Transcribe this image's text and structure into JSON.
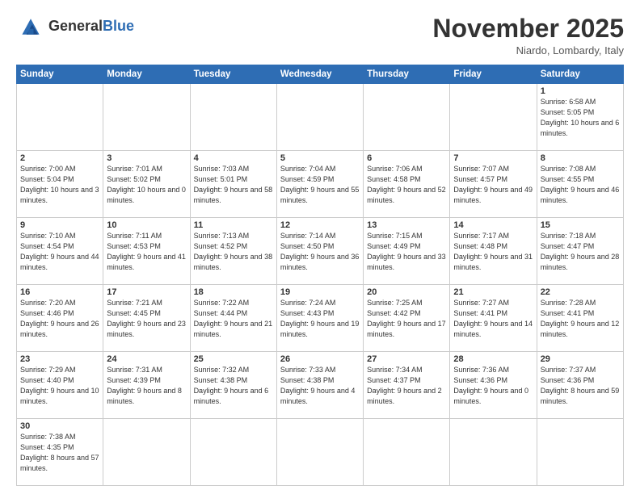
{
  "header": {
    "logo_general": "General",
    "logo_blue": "Blue",
    "month_title": "November 2025",
    "location": "Niardo, Lombardy, Italy"
  },
  "days_of_week": [
    "Sunday",
    "Monday",
    "Tuesday",
    "Wednesday",
    "Thursday",
    "Friday",
    "Saturday"
  ],
  "weeks": [
    [
      {
        "day": "",
        "info": ""
      },
      {
        "day": "",
        "info": ""
      },
      {
        "day": "",
        "info": ""
      },
      {
        "day": "",
        "info": ""
      },
      {
        "day": "",
        "info": ""
      },
      {
        "day": "",
        "info": ""
      },
      {
        "day": "1",
        "info": "Sunrise: 6:58 AM\nSunset: 5:05 PM\nDaylight: 10 hours and 6 minutes."
      }
    ],
    [
      {
        "day": "2",
        "info": "Sunrise: 7:00 AM\nSunset: 5:04 PM\nDaylight: 10 hours and 3 minutes."
      },
      {
        "day": "3",
        "info": "Sunrise: 7:01 AM\nSunset: 5:02 PM\nDaylight: 10 hours and 0 minutes."
      },
      {
        "day": "4",
        "info": "Sunrise: 7:03 AM\nSunset: 5:01 PM\nDaylight: 9 hours and 58 minutes."
      },
      {
        "day": "5",
        "info": "Sunrise: 7:04 AM\nSunset: 4:59 PM\nDaylight: 9 hours and 55 minutes."
      },
      {
        "day": "6",
        "info": "Sunrise: 7:06 AM\nSunset: 4:58 PM\nDaylight: 9 hours and 52 minutes."
      },
      {
        "day": "7",
        "info": "Sunrise: 7:07 AM\nSunset: 4:57 PM\nDaylight: 9 hours and 49 minutes."
      },
      {
        "day": "8",
        "info": "Sunrise: 7:08 AM\nSunset: 4:55 PM\nDaylight: 9 hours and 46 minutes."
      }
    ],
    [
      {
        "day": "9",
        "info": "Sunrise: 7:10 AM\nSunset: 4:54 PM\nDaylight: 9 hours and 44 minutes."
      },
      {
        "day": "10",
        "info": "Sunrise: 7:11 AM\nSunset: 4:53 PM\nDaylight: 9 hours and 41 minutes."
      },
      {
        "day": "11",
        "info": "Sunrise: 7:13 AM\nSunset: 4:52 PM\nDaylight: 9 hours and 38 minutes."
      },
      {
        "day": "12",
        "info": "Sunrise: 7:14 AM\nSunset: 4:50 PM\nDaylight: 9 hours and 36 minutes."
      },
      {
        "day": "13",
        "info": "Sunrise: 7:15 AM\nSunset: 4:49 PM\nDaylight: 9 hours and 33 minutes."
      },
      {
        "day": "14",
        "info": "Sunrise: 7:17 AM\nSunset: 4:48 PM\nDaylight: 9 hours and 31 minutes."
      },
      {
        "day": "15",
        "info": "Sunrise: 7:18 AM\nSunset: 4:47 PM\nDaylight: 9 hours and 28 minutes."
      }
    ],
    [
      {
        "day": "16",
        "info": "Sunrise: 7:20 AM\nSunset: 4:46 PM\nDaylight: 9 hours and 26 minutes."
      },
      {
        "day": "17",
        "info": "Sunrise: 7:21 AM\nSunset: 4:45 PM\nDaylight: 9 hours and 23 minutes."
      },
      {
        "day": "18",
        "info": "Sunrise: 7:22 AM\nSunset: 4:44 PM\nDaylight: 9 hours and 21 minutes."
      },
      {
        "day": "19",
        "info": "Sunrise: 7:24 AM\nSunset: 4:43 PM\nDaylight: 9 hours and 19 minutes."
      },
      {
        "day": "20",
        "info": "Sunrise: 7:25 AM\nSunset: 4:42 PM\nDaylight: 9 hours and 17 minutes."
      },
      {
        "day": "21",
        "info": "Sunrise: 7:27 AM\nSunset: 4:41 PM\nDaylight: 9 hours and 14 minutes."
      },
      {
        "day": "22",
        "info": "Sunrise: 7:28 AM\nSunset: 4:41 PM\nDaylight: 9 hours and 12 minutes."
      }
    ],
    [
      {
        "day": "23",
        "info": "Sunrise: 7:29 AM\nSunset: 4:40 PM\nDaylight: 9 hours and 10 minutes."
      },
      {
        "day": "24",
        "info": "Sunrise: 7:31 AM\nSunset: 4:39 PM\nDaylight: 9 hours and 8 minutes."
      },
      {
        "day": "25",
        "info": "Sunrise: 7:32 AM\nSunset: 4:38 PM\nDaylight: 9 hours and 6 minutes."
      },
      {
        "day": "26",
        "info": "Sunrise: 7:33 AM\nSunset: 4:38 PM\nDaylight: 9 hours and 4 minutes."
      },
      {
        "day": "27",
        "info": "Sunrise: 7:34 AM\nSunset: 4:37 PM\nDaylight: 9 hours and 2 minutes."
      },
      {
        "day": "28",
        "info": "Sunrise: 7:36 AM\nSunset: 4:36 PM\nDaylight: 9 hours and 0 minutes."
      },
      {
        "day": "29",
        "info": "Sunrise: 7:37 AM\nSunset: 4:36 PM\nDaylight: 8 hours and 59 minutes."
      }
    ],
    [
      {
        "day": "30",
        "info": "Sunrise: 7:38 AM\nSunset: 4:35 PM\nDaylight: 8 hours and 57 minutes."
      },
      {
        "day": "",
        "info": ""
      },
      {
        "day": "",
        "info": ""
      },
      {
        "day": "",
        "info": ""
      },
      {
        "day": "",
        "info": ""
      },
      {
        "day": "",
        "info": ""
      },
      {
        "day": "",
        "info": ""
      }
    ]
  ],
  "colors": {
    "header_bg": "#2e6db4",
    "header_text": "#ffffff",
    "border": "#cccccc"
  }
}
